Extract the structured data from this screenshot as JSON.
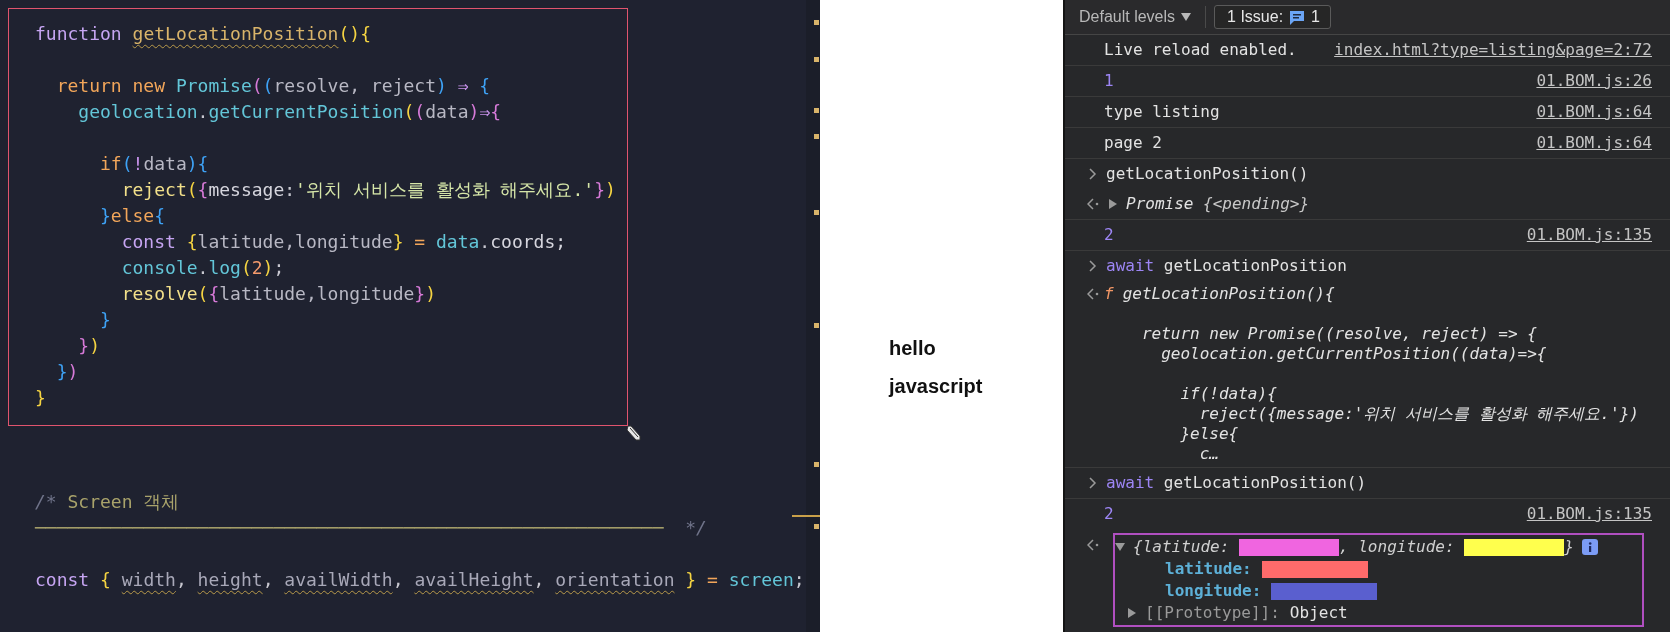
{
  "editor": {
    "lines": [
      {
        "kind": "code",
        "tokens": [
          {
            "text": "function ",
            "kind": "kw"
          },
          {
            "text": "getLocationPosition",
            "kind": "warnfn"
          },
          {
            "text": "(){",
            "kind": "b1"
          }
        ]
      },
      {
        "kind": "blank"
      },
      {
        "kind": "code",
        "tokens": [
          {
            "text": "  return new ",
            "kind": "ctl"
          },
          {
            "text": "Promise",
            "kind": "obj"
          },
          {
            "text": "(",
            "kind": "b2"
          },
          {
            "text": "(",
            "kind": "b3"
          },
          {
            "text": "resolve, reject",
            "kind": "var"
          },
          {
            "text": ")",
            "kind": "b3"
          },
          {
            "text": " ⇒ ",
            "kind": "op"
          },
          {
            "text": "{",
            "kind": "b3"
          }
        ]
      },
      {
        "kind": "code",
        "tokens": [
          {
            "text": "    geolocation",
            "kind": "obj"
          },
          {
            "text": ".",
            "kind": "punct"
          },
          {
            "text": "getCurrentPosition",
            "kind": "obj"
          },
          {
            "text": "(",
            "kind": "b1"
          },
          {
            "text": "(",
            "kind": "b2"
          },
          {
            "text": "data",
            "kind": "var"
          },
          {
            "text": ")",
            "kind": "b2"
          },
          {
            "text": "⇒",
            "kind": "op"
          },
          {
            "text": "{",
            "kind": "b2"
          }
        ]
      },
      {
        "kind": "blank"
      },
      {
        "kind": "code",
        "tokens": [
          {
            "text": "      if",
            "kind": "ctl"
          },
          {
            "text": "(",
            "kind": "b3"
          },
          {
            "text": "!",
            "kind": "op"
          },
          {
            "text": "data",
            "kind": "var"
          },
          {
            "text": ")",
            "kind": "b3"
          },
          {
            "text": "{",
            "kind": "b3"
          }
        ]
      },
      {
        "kind": "code",
        "tokens": [
          {
            "text": "        reject",
            "kind": "fn"
          },
          {
            "text": "(",
            "kind": "b1"
          },
          {
            "text": "{",
            "kind": "b2"
          },
          {
            "text": "message",
            "kind": "prop"
          },
          {
            "text": ":",
            "kind": "punct"
          },
          {
            "text": "'위치 서비스를 활성화 해주세요.'",
            "kind": "str"
          },
          {
            "text": "}",
            "kind": "b2"
          },
          {
            "text": ")",
            "kind": "b1"
          }
        ]
      },
      {
        "kind": "code",
        "tokens": [
          {
            "text": "      }",
            "kind": "b3"
          },
          {
            "text": "else",
            "kind": "ctl"
          },
          {
            "text": "{",
            "kind": "b3"
          }
        ]
      },
      {
        "kind": "code",
        "tokens": [
          {
            "text": "        const ",
            "kind": "kw"
          },
          {
            "text": "{",
            "kind": "b1"
          },
          {
            "text": "latitude,longitude",
            "kind": "var"
          },
          {
            "text": "}",
            "kind": "b1"
          },
          {
            "text": " = ",
            "kind": "eq"
          },
          {
            "text": "data",
            "kind": "obj"
          },
          {
            "text": ".",
            "kind": "punct"
          },
          {
            "text": "coords;",
            "kind": "prop"
          }
        ]
      },
      {
        "kind": "code",
        "tokens": [
          {
            "text": "        console",
            "kind": "obj"
          },
          {
            "text": ".",
            "kind": "punct"
          },
          {
            "text": "log",
            "kind": "obj"
          },
          {
            "text": "(",
            "kind": "b1"
          },
          {
            "text": "2",
            "kind": "num"
          },
          {
            "text": ")",
            "kind": "b1"
          },
          {
            "text": ";",
            "kind": "punct"
          }
        ]
      },
      {
        "kind": "code",
        "tokens": [
          {
            "text": "        resolve",
            "kind": "fn"
          },
          {
            "text": "(",
            "kind": "b1"
          },
          {
            "text": "{",
            "kind": "b2"
          },
          {
            "text": "latitude,longitude",
            "kind": "var"
          },
          {
            "text": "}",
            "kind": "b2"
          },
          {
            "text": ")",
            "kind": "b1"
          }
        ]
      },
      {
        "kind": "code",
        "tokens": [
          {
            "text": "      }",
            "kind": "b3"
          }
        ]
      },
      {
        "kind": "code",
        "tokens": [
          {
            "text": "    }",
            "kind": "b2"
          },
          {
            "text": ")",
            "kind": "b1"
          }
        ]
      },
      {
        "kind": "code",
        "tokens": [
          {
            "text": "  }",
            "kind": "b3"
          },
          {
            "text": ")",
            "kind": "b2"
          }
        ]
      },
      {
        "kind": "code",
        "tokens": [
          {
            "text": "}",
            "kind": "b1"
          }
        ]
      },
      {
        "kind": "blank"
      },
      {
        "kind": "blank"
      },
      {
        "kind": "blank"
      },
      {
        "kind": "code",
        "tokens": [
          {
            "text": "/* ",
            "kind": "cmark"
          },
          {
            "text": "Screen 객체",
            "kind": "comment"
          }
        ]
      },
      {
        "kind": "code",
        "tokens": [
          {
            "text": "──────────────────────────────────────────────────────────",
            "kind": "comment"
          },
          {
            "text": "  */",
            "kind": "cmark"
          }
        ]
      },
      {
        "kind": "blank"
      },
      {
        "kind": "code",
        "tokens": [
          {
            "text": "const ",
            "kind": "kw"
          },
          {
            "text": "{ ",
            "kind": "b1"
          },
          {
            "text": "width",
            "kind": "warnvar"
          },
          {
            "text": ", ",
            "kind": "punct"
          },
          {
            "text": "height",
            "kind": "warnvar"
          },
          {
            "text": ", ",
            "kind": "punct"
          },
          {
            "text": "availWidth",
            "kind": "warnvar"
          },
          {
            "text": ", ",
            "kind": "punct"
          },
          {
            "text": "availHeight",
            "kind": "warnvar"
          },
          {
            "text": ", ",
            "kind": "punct"
          },
          {
            "text": "orientation",
            "kind": "warnvar"
          },
          {
            "text": " }",
            "kind": "b1"
          },
          {
            "text": " = ",
            "kind": "eq"
          },
          {
            "text": "screen",
            "kind": "obj"
          },
          {
            "text": ";",
            "kind": "punct"
          }
        ]
      }
    ]
  },
  "note": {
    "text": "hello javascript"
  },
  "console": {
    "toolbar": {
      "levels_label": "Default levels",
      "issues_label": "1 Issue:",
      "issues_count": "1"
    },
    "entries": [
      {
        "kind": "log",
        "message": {
          "kind": "text",
          "text": "Live reload enabled."
        },
        "source": "index.html?type=listing&page=2:72"
      },
      {
        "kind": "log",
        "message": {
          "kind": "number",
          "text": "1"
        },
        "source": "01.BOM.js:26"
      },
      {
        "kind": "log",
        "message": {
          "kind": "text",
          "text": "type listing"
        },
        "source": "01.BOM.js:64"
      },
      {
        "kind": "log",
        "message": {
          "kind": "text",
          "text": "page 2"
        },
        "source": "01.BOM.js:64"
      },
      {
        "kind": "input",
        "tokens": [
          {
            "text": "getLocationPosition()",
            "kind": "plain"
          }
        ]
      },
      {
        "kind": "output",
        "result": {
          "kind": "promise",
          "expanded": false,
          "name": "Promise",
          "preview": "{<pending>}"
        }
      },
      {
        "kind": "log",
        "message": {
          "kind": "number",
          "text": "2"
        },
        "source": "01.BOM.js:135"
      },
      {
        "kind": "input",
        "tokens": [
          {
            "text": "await ",
            "kind": "keyword"
          },
          {
            "text": "getLocationPosition",
            "kind": "plain"
          }
        ]
      },
      {
        "kind": "output",
        "result": {
          "kind": "function",
          "glyph": "f",
          "source": "getLocationPosition(){\n\n  return new Promise((resolve, reject) => {\n    geolocation.getCurrentPosition((data)=>{\n\n      if(!data){\n        reject({message:'위치 서비스를 활성화 해주세요.'})\n      }else{\n        c…"
        }
      },
      {
        "kind": "input",
        "tokens": [
          {
            "text": "await ",
            "kind": "keyword"
          },
          {
            "text": "getLocationPosition()",
            "kind": "plain"
          }
        ]
      },
      {
        "kind": "log",
        "message": {
          "kind": "number",
          "text": "2"
        },
        "source": "01.BOM.js:135"
      },
      {
        "kind": "output",
        "result": {
          "kind": "object",
          "expanded": true,
          "preview": [
            {
              "kind": "text",
              "text": "{latitude: "
            },
            {
              "kind": "redaction",
              "color": "#f065e0"
            },
            {
              "kind": "text",
              "text": ", longitude: "
            },
            {
              "kind": "redaction",
              "color": "#ffff4d"
            },
            {
              "kind": "text",
              "text": "}"
            }
          ],
          "properties": [
            {
              "kind": "redacted",
              "key": "latitude:",
              "color": "#ff6b6b"
            },
            {
              "kind": "redacted",
              "key": "longitude:",
              "color": "#5a5fcf"
            },
            {
              "kind": "object",
              "key": "[[Prototype]]:",
              "value": "Object",
              "expanded": false
            }
          ]
        }
      }
    ]
  }
}
